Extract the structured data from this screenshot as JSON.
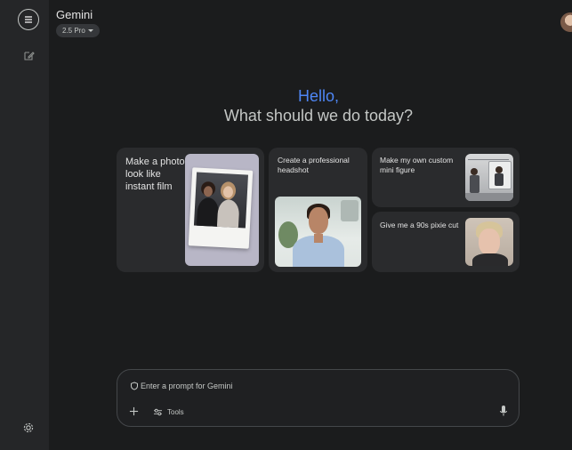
{
  "app": {
    "title": "Gemini",
    "model": "2.5 Pro"
  },
  "sidebar": {
    "menu_icon": "hamburger-icon",
    "new_chat_icon": "edit-icon",
    "settings_icon": "gear-icon"
  },
  "greeting": {
    "hello": "Hello,",
    "subtitle": "What should we do today?"
  },
  "cards": [
    {
      "label": "Make a photo look like instant film",
      "image": "instant-film-photo"
    },
    {
      "label": "Create a professional headshot",
      "image": "headshot-photo"
    },
    {
      "label": "Make my own custom mini figure",
      "image": "mini-figure-photo"
    },
    {
      "label": "Give me a 90s pixie cut",
      "image": "pixie-cut-photo"
    }
  ],
  "prompt": {
    "placeholder": "Enter a prompt for Gemini",
    "tools_label": "Tools"
  },
  "colors": {
    "background": "#1b1c1d",
    "sidebar": "#252628",
    "card": "#2a2b2d",
    "accent": "#4e86f5"
  }
}
